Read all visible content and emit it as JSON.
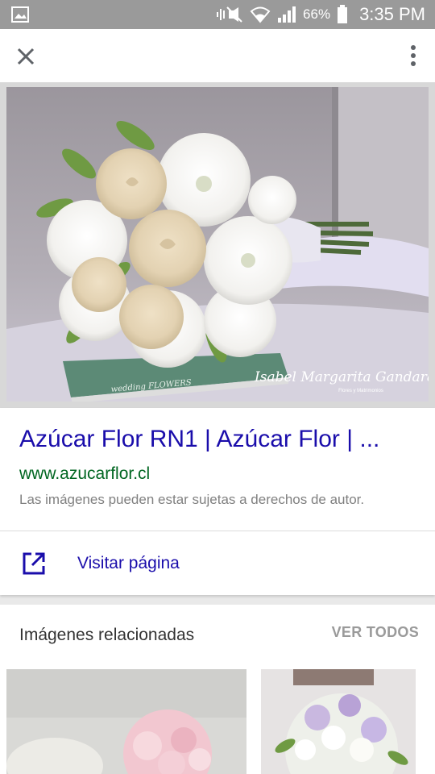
{
  "status_bar": {
    "left_icon": "gallery-icon",
    "icons": [
      "mute-icon",
      "wifi-icon",
      "signal-icon",
      "battery-icon"
    ],
    "battery": "66%",
    "time": "3:35 PM"
  },
  "app_bar": {
    "close_icon": "close-icon",
    "menu_icon": "more-vert-icon"
  },
  "image": {
    "watermark": "Isabel Margarita Gandara",
    "watermark_sub": "Flores y Matrimonios",
    "book_title": "wedding FLOWERS"
  },
  "result": {
    "title": "Azúcar Flor RN1 | Azúcar Flor | ...",
    "url": "www.azucarflor.cl",
    "copyright": "Las imágenes pueden estar sujetas a derechos de autor.",
    "visit_label": "Visitar página",
    "visit_icon": "open-in-new-icon"
  },
  "related": {
    "title": "Imágenes relacionadas",
    "see_all": "VER TODOS"
  },
  "colors": {
    "link": "#1a0dab",
    "url": "#006621",
    "muted": "#808080",
    "status_bar": "#9a9a9a"
  }
}
